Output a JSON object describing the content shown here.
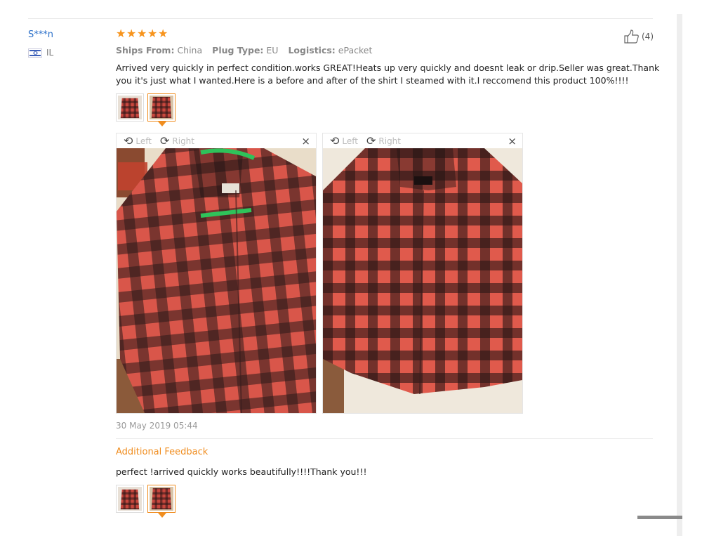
{
  "buyer": {
    "name": "S***n",
    "country": "IL",
    "flag_icon": "israel-flag-icon"
  },
  "rating": {
    "stars": 5,
    "star_color": "#f7941d"
  },
  "helpful": {
    "count_label": "(4)",
    "icon": "thumbs-up-icon"
  },
  "meta": {
    "ships_from_label": "Ships From:",
    "ships_from_value": "China",
    "plug_type_label": "Plug Type:",
    "plug_type_value": "EU",
    "logistics_label": "Logistics:",
    "logistics_value": "ePacket"
  },
  "review": {
    "text": "Arrived very quickly in perfect condition.works GREAT!Heats up very quickly and doesnt leak or drip.Seller was great.Thank you it's just what I wanted.Here is a before and after of the shirt I steamed with it.I reccomend this product 100%!!!!",
    "date": "30 May 2019 05:44"
  },
  "viewer": {
    "left_label": "Left",
    "right_label": "Right",
    "close_glyph": "×"
  },
  "additional": {
    "title": "Additional Feedback",
    "text": "perfect !arrived quickly works beautifully!!!!Thank you!!!"
  },
  "colors": {
    "accent": "#f08d1f",
    "link": "#2a6fc9"
  }
}
